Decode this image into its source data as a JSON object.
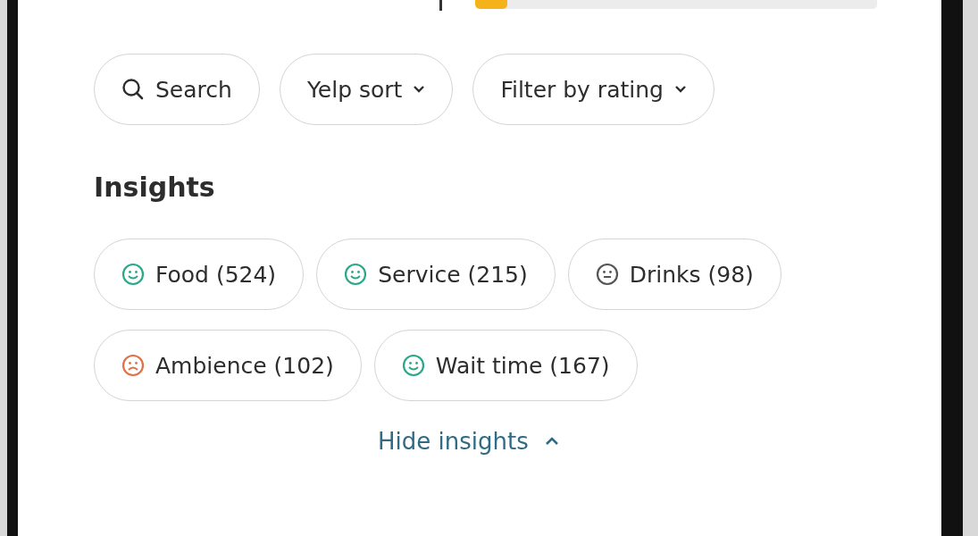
{
  "rating_bar": {
    "level": 0.08
  },
  "filters": [
    {
      "kind": "search",
      "label": "Search"
    },
    {
      "kind": "dropdown",
      "label": "Yelp sort"
    },
    {
      "kind": "dropdown",
      "label": "Filter by rating"
    }
  ],
  "insights": {
    "title": "Insights",
    "items": [
      {
        "label": "Food (524)",
        "kind": "positive",
        "color": "#2aa889"
      },
      {
        "label": "Service (215)",
        "kind": "positive",
        "color": "#2aa889"
      },
      {
        "label": "Drinks (98)",
        "kind": "neutral",
        "color": "#555555"
      },
      {
        "label": "Ambience (102)",
        "kind": "negative",
        "color": "#e0724a"
      },
      {
        "label": "Wait time (167)",
        "kind": "positive",
        "color": "#2aa889"
      }
    ],
    "toggle": "Hide insights"
  }
}
